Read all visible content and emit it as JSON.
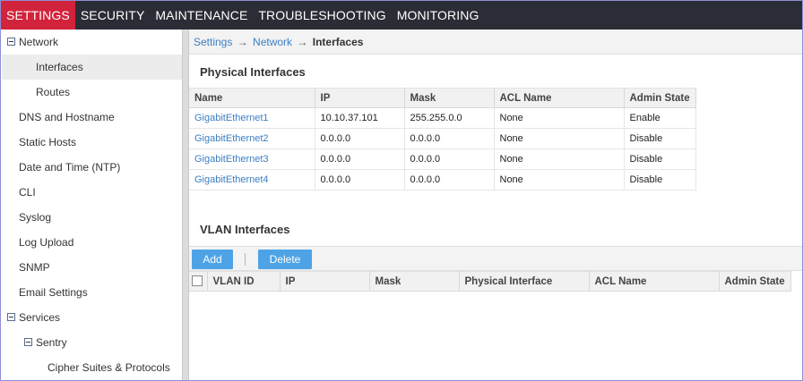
{
  "topnav": {
    "items": [
      {
        "label": "SETTINGS",
        "active": true
      },
      {
        "label": "SECURITY",
        "active": false
      },
      {
        "label": "MAINTENANCE",
        "active": false
      },
      {
        "label": "TROUBLESHOOTING",
        "active": false
      },
      {
        "label": "MONITORING",
        "active": false
      }
    ],
    "active_color": "#d2233c",
    "bar_color": "#2b2d36"
  },
  "sidebar": {
    "items": [
      {
        "label": "Network",
        "expander": "collapse-icon"
      },
      {
        "label": "Interfaces",
        "selected": true
      },
      {
        "label": "Routes"
      },
      {
        "label": "DNS and Hostname"
      },
      {
        "label": "Static Hosts"
      },
      {
        "label": "Date and Time (NTP)"
      },
      {
        "label": "CLI"
      },
      {
        "label": "Syslog"
      },
      {
        "label": "Log Upload"
      },
      {
        "label": "SNMP"
      },
      {
        "label": "Email Settings"
      },
      {
        "label": "Services",
        "expander": "collapse-icon"
      },
      {
        "label": "Sentry",
        "expander": "collapse-icon"
      },
      {
        "label": "Cipher Suites & Protocols"
      }
    ]
  },
  "breadcrumb": {
    "items": [
      "Settings",
      "Network"
    ],
    "separator": "→",
    "current": "Interfaces",
    "link_color": "#3c7fc2"
  },
  "physical": {
    "title": "Physical Interfaces",
    "columns": [
      "Name",
      "IP",
      "Mask",
      "ACL Name",
      "Admin State"
    ],
    "rows": [
      [
        "GigabitEthernet1",
        "10.10.37.101",
        "255.255.0.0",
        "None",
        "Enable"
      ],
      [
        "GigabitEthernet2",
        "0.0.0.0",
        "0.0.0.0",
        "None",
        "Disable"
      ],
      [
        "GigabitEthernet3",
        "0.0.0.0",
        "0.0.0.0",
        "None",
        "Disable"
      ],
      [
        "GigabitEthernet4",
        "0.0.0.0",
        "0.0.0.0",
        "None",
        "Disable"
      ]
    ]
  },
  "vlan": {
    "title": "VLAN Interfaces",
    "add_label": "Add",
    "delete_label": "Delete",
    "button_color": "#4ea3e6",
    "columns": [
      "VLAN ID",
      "IP",
      "Mask",
      "Physical Interface",
      "ACL Name",
      "Admin State"
    ]
  }
}
